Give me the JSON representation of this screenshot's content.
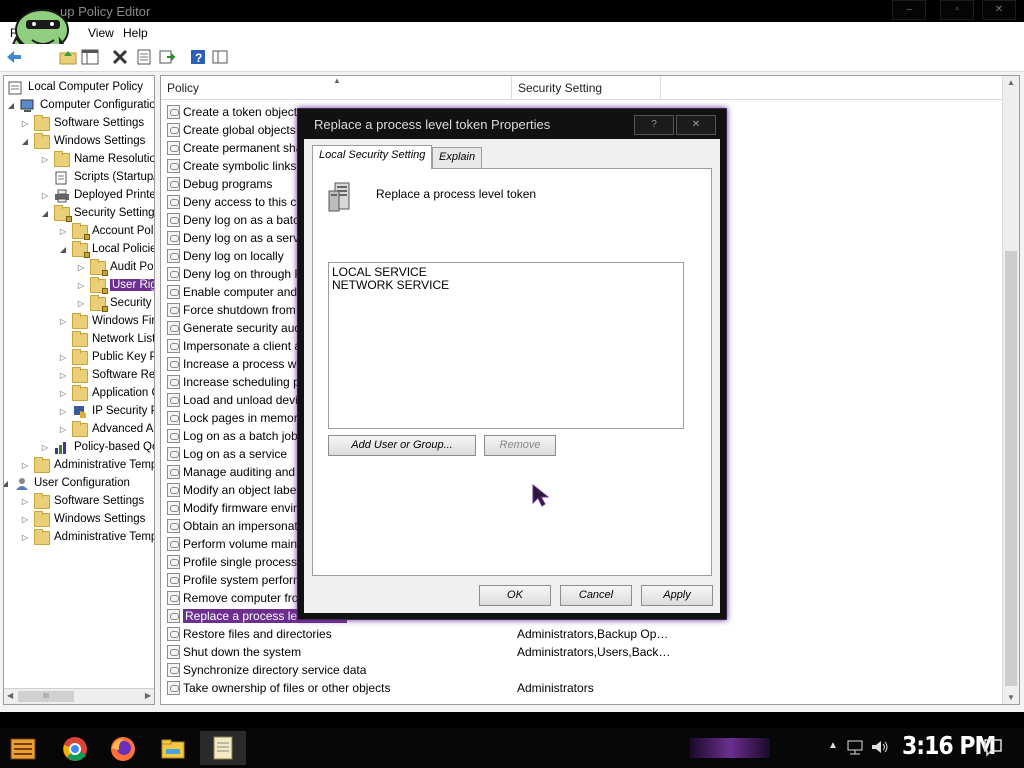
{
  "window": {
    "title": "Local Group Policy Editor",
    "title_visible": "up Policy Editor",
    "controls": [
      "–",
      "▫",
      "✕"
    ]
  },
  "menu": {
    "file": "File",
    "view": "View",
    "help": "Help"
  },
  "toolbar": {
    "icons": [
      "back-icon",
      "up-folder-icon",
      "show-hide-tree-icon",
      "delete-icon",
      "properties-icon",
      "export-list-icon",
      "help-icon",
      "extended-view-icon"
    ]
  },
  "tree": {
    "items": [
      {
        "label": "Local Computer Policy",
        "expander": ""
      },
      {
        "label": "Computer Configuration",
        "expander": "◢"
      },
      {
        "label": "Software Settings",
        "expander": "▷"
      },
      {
        "label": "Windows Settings",
        "expander": "◢"
      },
      {
        "label": "Name Resolution Policy",
        "expander": "▷"
      },
      {
        "label": "Scripts (Startup/Shutdown)",
        "expander": ""
      },
      {
        "label": "Deployed Printers",
        "expander": "▷"
      },
      {
        "label": "Security Settings",
        "expander": "◢"
      },
      {
        "label": "Account Policies",
        "expander": "▷"
      },
      {
        "label": "Local Policies",
        "expander": "◢"
      },
      {
        "label": "Audit Policy",
        "expander": "▷"
      },
      {
        "label": "User Rights Assignment",
        "expander": "▷"
      },
      {
        "label": "Security Options",
        "expander": "▷"
      },
      {
        "label": "Windows Firewall",
        "expander": "▷"
      },
      {
        "label": "Network List Manager Policies",
        "expander": ""
      },
      {
        "label": "Public Key Policies",
        "expander": "▷"
      },
      {
        "label": "Software Restriction Policies",
        "expander": "▷"
      },
      {
        "label": "Application Control Policies",
        "expander": "▷"
      },
      {
        "label": "IP Security Policies",
        "expander": "▷"
      },
      {
        "label": "Advanced Audit Policy",
        "expander": "▷"
      },
      {
        "label": "Policy-based QoS",
        "expander": "▷"
      },
      {
        "label": "Administrative Templates",
        "expander": "▷"
      },
      {
        "label": "User Configuration",
        "expander": "◢"
      },
      {
        "label": "Software Settings",
        "expander": "▷"
      },
      {
        "label": "Windows Settings",
        "expander": "▷"
      },
      {
        "label": "Administrative Templates",
        "expander": "▷"
      }
    ],
    "scroll_thumb": "III"
  },
  "list": {
    "col_policy": "Policy",
    "col_setting": "Security Setting",
    "rows": [
      {
        "name": "Create a token object",
        "value": ""
      },
      {
        "name": "Create global objects",
        "value": ""
      },
      {
        "name": "Create permanent shared objects",
        "value": ""
      },
      {
        "name": "Create symbolic links",
        "value": ""
      },
      {
        "name": "Debug programs",
        "value": ""
      },
      {
        "name": "Deny access to this computer from the network",
        "value": ""
      },
      {
        "name": "Deny log on as a batch job",
        "value": ""
      },
      {
        "name": "Deny log on as a service",
        "value": ""
      },
      {
        "name": "Deny log on locally",
        "value": ""
      },
      {
        "name": "Deny log on through Remote Desktop Services",
        "value": ""
      },
      {
        "name": "Enable computer and user accounts to be trusted for delegation",
        "value": ""
      },
      {
        "name": "Force shutdown from a remote system",
        "value": ""
      },
      {
        "name": "Generate security audits",
        "value": ""
      },
      {
        "name": "Impersonate a client after authentication",
        "value": ""
      },
      {
        "name": "Increase a process working set",
        "value": ""
      },
      {
        "name": "Increase scheduling priority",
        "value": ""
      },
      {
        "name": "Load and unload device drivers",
        "value": ""
      },
      {
        "name": "Lock pages in memory",
        "value": ""
      },
      {
        "name": "Log on as a batch job",
        "value": ""
      },
      {
        "name": "Log on as a service",
        "value": ""
      },
      {
        "name": "Manage auditing and security log",
        "value": ""
      },
      {
        "name": "Modify an object label",
        "value": ""
      },
      {
        "name": "Modify firmware environment values",
        "value": ""
      },
      {
        "name": "Obtain an impersonation token for another user in the same session",
        "value": ""
      },
      {
        "name": "Perform volume maintenance tasks",
        "value": ""
      },
      {
        "name": "Profile single process",
        "value": ""
      },
      {
        "name": "Profile system performance",
        "value": ""
      },
      {
        "name": "Remove computer from docking station",
        "value": ""
      },
      {
        "name": "Replace a process level token",
        "value": ""
      },
      {
        "name": "Restore files and directories",
        "value": "Administrators,Backup Op…"
      },
      {
        "name": "Shut down the system",
        "value": "Administrators,Users,Back…"
      },
      {
        "name": "Synchronize directory service data",
        "value": ""
      },
      {
        "name": "Take ownership of files or other objects",
        "value": "Administrators"
      }
    ]
  },
  "dialog": {
    "title": "Replace a process level token Properties",
    "help_btn": "?",
    "close_btn": "✕",
    "tab_local": "Local Security Setting",
    "tab_explain": "Explain",
    "policy_name": "Replace a process level token",
    "accounts": [
      "LOCAL SERVICE",
      "NETWORK SERVICE"
    ],
    "add_button": "Add User or Group...",
    "remove_button": "Remove",
    "ok": "OK",
    "cancel": "Cancel",
    "apply": "Apply"
  },
  "taskbar": {
    "clock": "3:16 PM",
    "apps": [
      "start-icon",
      "chrome-icon",
      "firefox-icon",
      "file-explorer-icon",
      "notepad-icon"
    ]
  },
  "colors": {
    "selection": "#6c2f8f",
    "accent": "#6c2f8f"
  }
}
